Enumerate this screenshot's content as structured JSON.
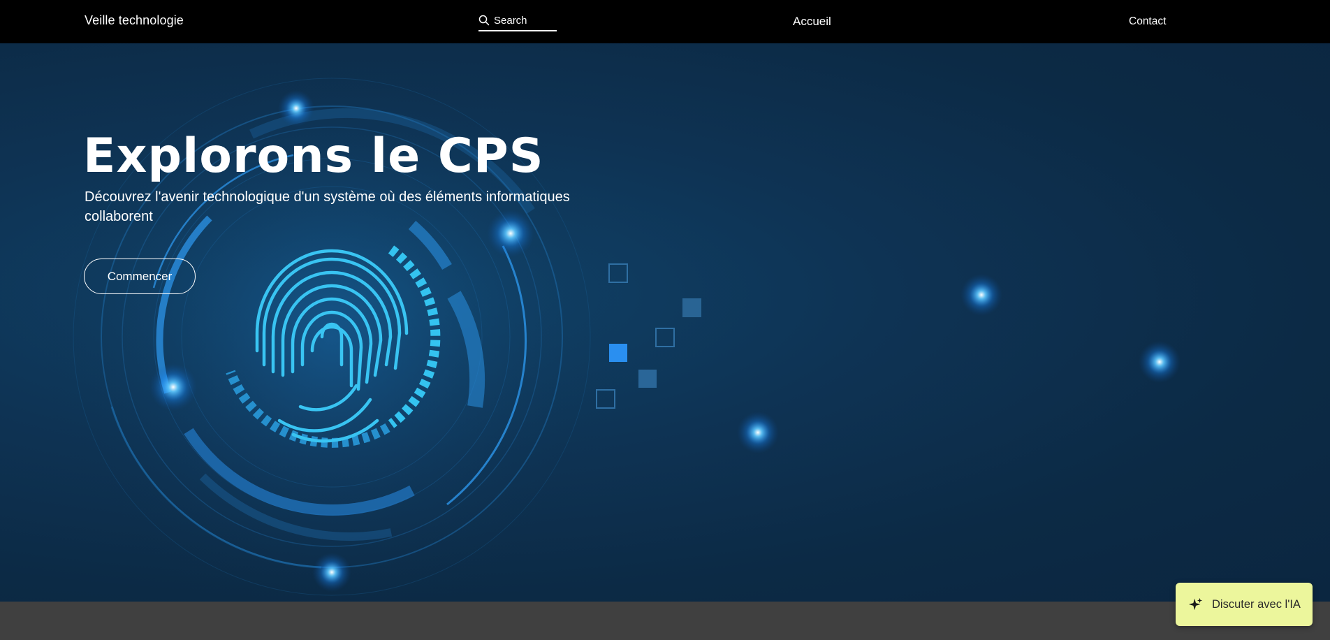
{
  "header": {
    "site_title": "Veille technologie",
    "search": {
      "placeholder": "Search",
      "icon": "search-icon"
    },
    "nav": {
      "home": "Accueil",
      "contact": "Contact"
    }
  },
  "hero": {
    "title": "Explorons le CPS",
    "subtitle": "Découvrez l'avenir technologique d'un système où des éléments informatiques collaborent",
    "cta_label": "Commencer",
    "background_image": "fingerprint-circuit-illustration"
  },
  "ai_chat": {
    "label": "Discuter avec l'IA",
    "icon": "sparkle-icon"
  },
  "colors": {
    "header_bg": "#000000",
    "hero_bg": "#0d2c47",
    "accent_glow": "#2aa8ff",
    "ai_button_bg": "#ecf69c",
    "bottom_strip": "#404040"
  }
}
